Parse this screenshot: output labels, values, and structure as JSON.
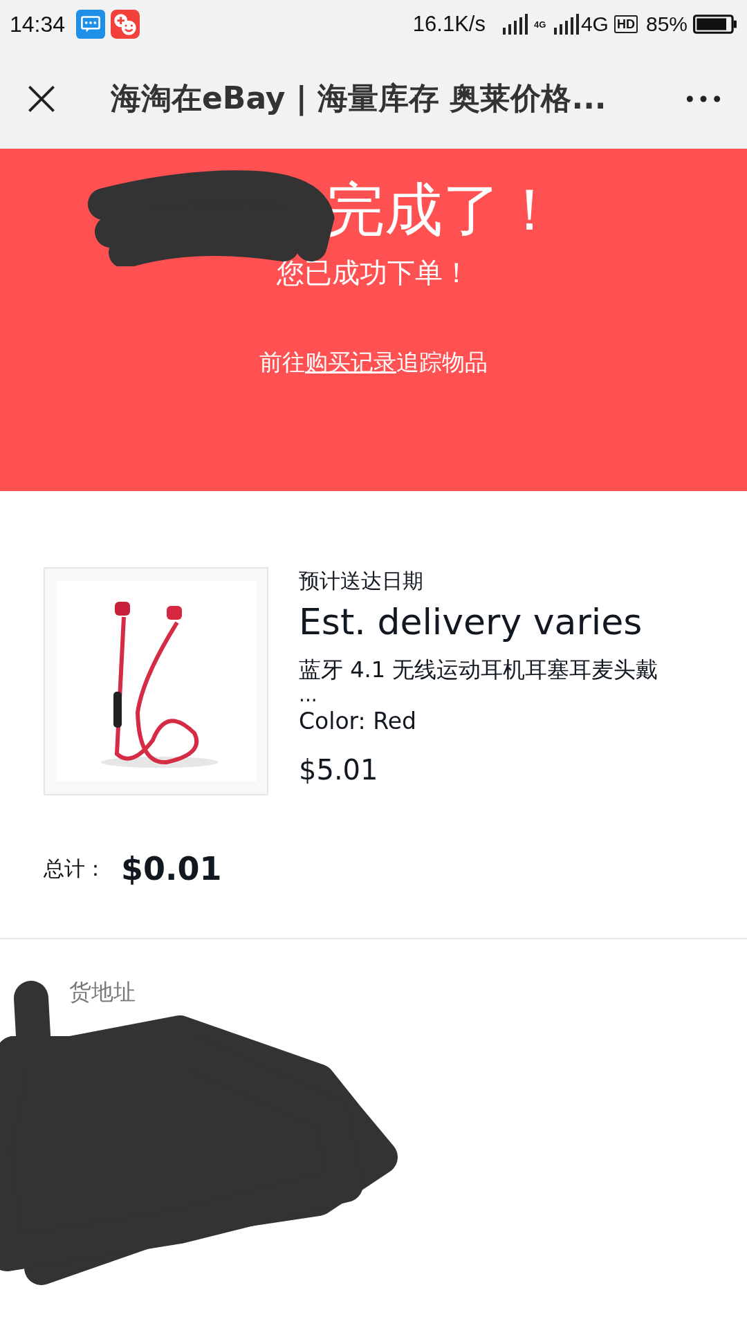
{
  "status_bar": {
    "time": "14:34",
    "speed": "16.1K/s",
    "network_small": "4G",
    "network": "4G",
    "hd": "HD",
    "battery": "85%"
  },
  "title_bar": {
    "title": "海淘在eBay | 海量库存 奥莱价格..."
  },
  "banner": {
    "heading": "完成了！",
    "subheading": "您已成功下单！",
    "link_prefix": "前往",
    "link": "购买记录",
    "link_suffix": "追踪物品"
  },
  "item": {
    "delivery_label": "预计送达日期",
    "delivery": "Est. delivery varies",
    "title": "蓝牙 4.1 无线运动耳机耳塞耳麦头戴",
    "ellipsis": "...",
    "variant": "Color: Red",
    "price": "$5.01"
  },
  "total": {
    "label": "总计：",
    "value": "$0.01"
  },
  "address": {
    "label": "货地址"
  }
}
